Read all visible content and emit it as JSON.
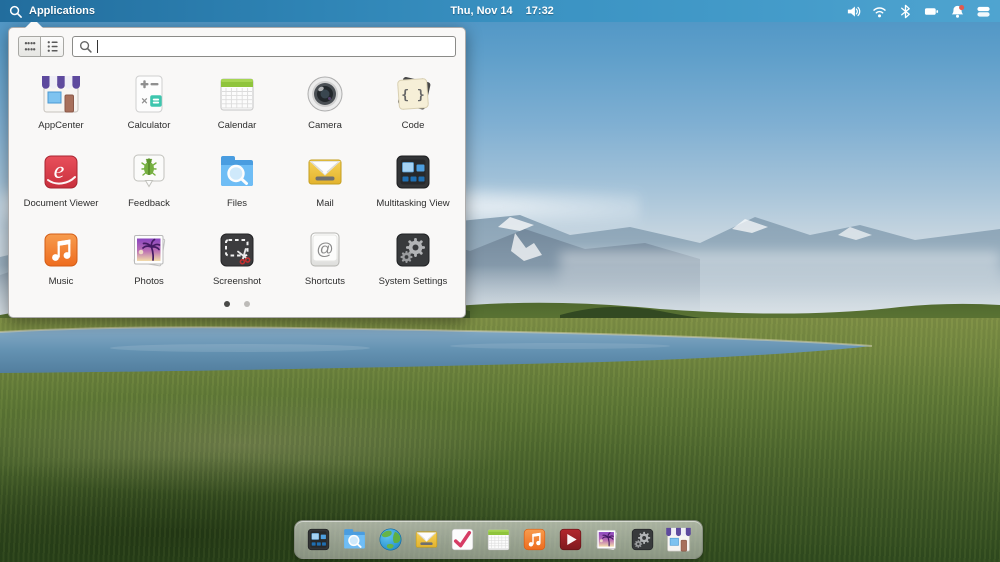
{
  "panel": {
    "app_menu_label": "Applications",
    "date": "Thu, Nov 14",
    "time": "17:32",
    "indicators": [
      {
        "name": "volume",
        "icon": "volume-icon"
      },
      {
        "name": "wifi",
        "icon": "wifi-icon"
      },
      {
        "name": "bluetooth",
        "icon": "bluetooth-icon"
      },
      {
        "name": "battery",
        "icon": "battery-icon"
      },
      {
        "name": "notifications",
        "icon": "bell-icon"
      },
      {
        "name": "session",
        "icon": "session-icon"
      }
    ],
    "colors": {
      "panel_blue": "#2e83b4",
      "text": "#ffffff",
      "badge_red": "#e05a4f"
    }
  },
  "launcher": {
    "view_toggles": [
      {
        "name": "grid-view",
        "icon": "grid-view-icon",
        "active": true
      },
      {
        "name": "category-view",
        "icon": "category-view-icon",
        "active": false
      }
    ],
    "search": {
      "value": "",
      "placeholder": ""
    },
    "apps": [
      {
        "label": "AppCenter",
        "icon": "appcenter"
      },
      {
        "label": "Calculator",
        "icon": "calculator"
      },
      {
        "label": "Calendar",
        "icon": "calendar"
      },
      {
        "label": "Camera",
        "icon": "camera"
      },
      {
        "label": "Code",
        "icon": "code"
      },
      {
        "label": "Document Viewer",
        "icon": "document-viewer"
      },
      {
        "label": "Feedback",
        "icon": "feedback"
      },
      {
        "label": "Files",
        "icon": "files"
      },
      {
        "label": "Mail",
        "icon": "mail"
      },
      {
        "label": "Multitasking View",
        "icon": "multitasking"
      },
      {
        "label": "Music",
        "icon": "music"
      },
      {
        "label": "Photos",
        "icon": "photos"
      },
      {
        "label": "Screenshot",
        "icon": "screenshot"
      },
      {
        "label": "Shortcuts",
        "icon": "shortcuts"
      },
      {
        "label": "System Settings",
        "icon": "settings"
      }
    ],
    "pages": {
      "count": 2,
      "active": 0
    }
  },
  "dock": {
    "items": [
      {
        "name": "Multitasking View",
        "icon": "multitasking"
      },
      {
        "name": "Files",
        "icon": "files"
      },
      {
        "name": "Web",
        "icon": "web"
      },
      {
        "name": "Mail",
        "icon": "mail"
      },
      {
        "name": "Tasks",
        "icon": "tasks"
      },
      {
        "name": "Calendar",
        "icon": "calendar"
      },
      {
        "name": "Music",
        "icon": "music"
      },
      {
        "name": "Videos",
        "icon": "videos"
      },
      {
        "name": "Photos",
        "icon": "photos"
      },
      {
        "name": "System Settings",
        "icon": "settings"
      },
      {
        "name": "AppCenter",
        "icon": "appcenter"
      }
    ]
  }
}
